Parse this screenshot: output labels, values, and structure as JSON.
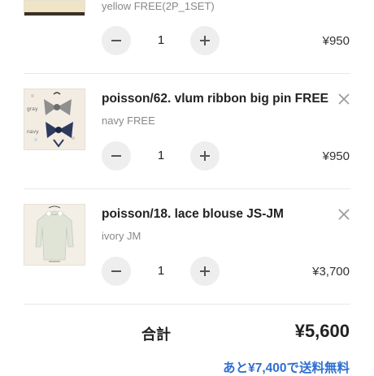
{
  "cart": {
    "items": [
      {
        "title": "",
        "variant": "yellow FREE(2P_1SET)",
        "quantity": "1",
        "price": "¥950",
        "thumb_icon": "product-image"
      },
      {
        "title": "poisson/62. vlum ribbon big pin FREE",
        "variant": "navy FREE",
        "quantity": "1",
        "price": "¥950",
        "thumb_icon": "ribbon-pin-image",
        "thumb_labels": [
          "gray",
          "navy"
        ]
      },
      {
        "title": "poisson/18. lace blouse JS-JM",
        "variant": "ivory JM",
        "quantity": "1",
        "price": "¥3,700",
        "thumb_icon": "lace-blouse-image"
      }
    ],
    "icons": {
      "decrement": "minus-icon",
      "increment": "plus-icon",
      "remove": "close-icon"
    }
  },
  "summary": {
    "total_label": "合計",
    "total_value": "¥5,600",
    "shipping_note": "あと¥7,400で送料無料",
    "accent_color": "#2f6fd0"
  }
}
